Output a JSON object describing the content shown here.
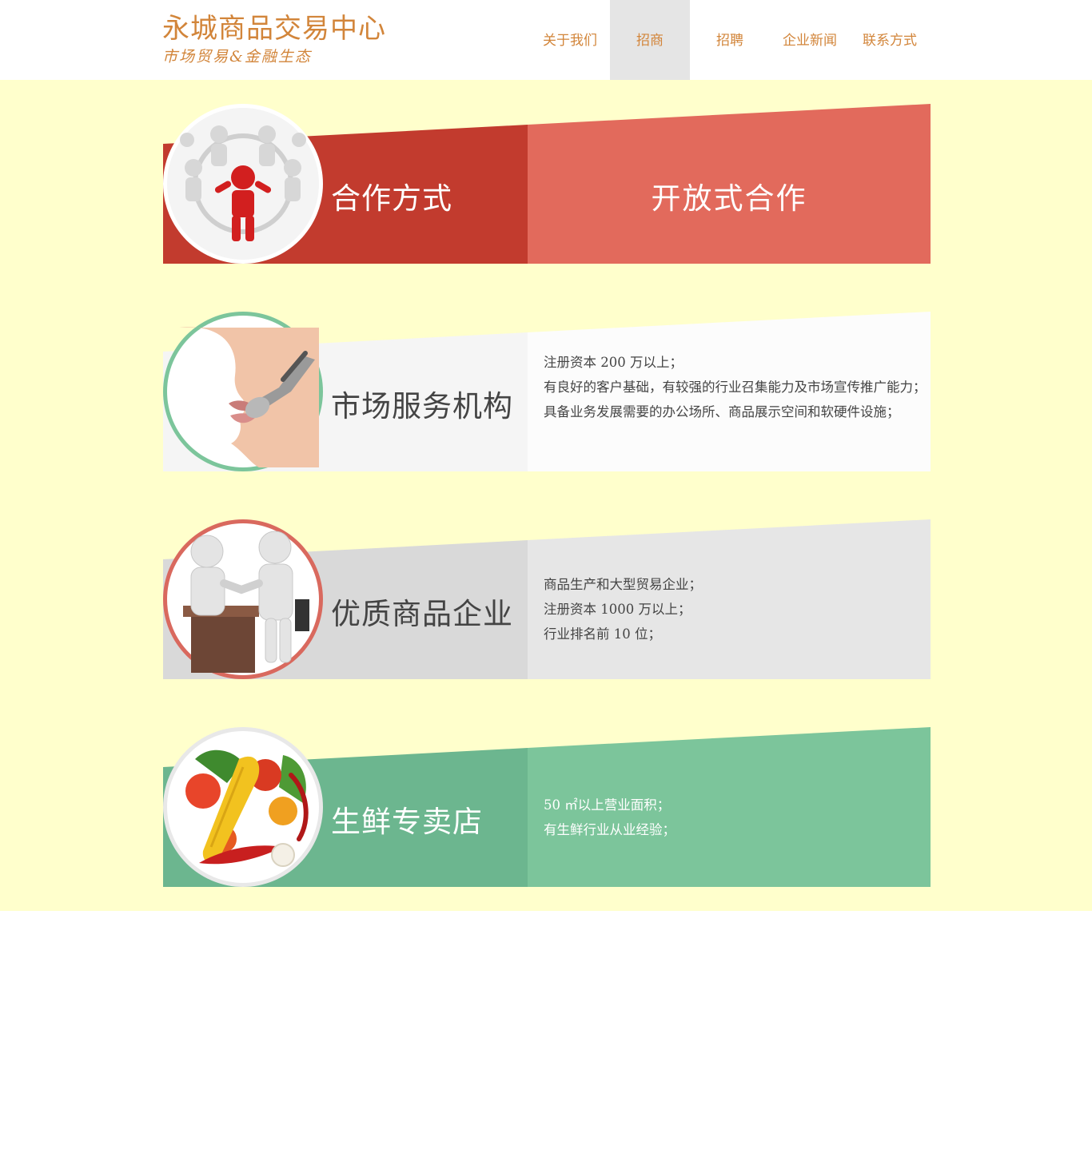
{
  "header": {
    "logo_title": "永城商品交易中心",
    "logo_subtitle": "市场贸易&金融生态",
    "nav": [
      {
        "label": "关于我们",
        "active": false
      },
      {
        "label": "招商",
        "active": true
      },
      {
        "label": "招聘",
        "active": false
      },
      {
        "label": "企业新闻",
        "active": false
      },
      {
        "label": "联系方式",
        "active": false
      }
    ]
  },
  "cards": [
    {
      "title": "合作方式",
      "right_title": "开放式合作",
      "lines": [],
      "colors": {
        "left": "#c23b2e",
        "right": "#e26a5c",
        "ring": "#ffffff",
        "title": "#ffffff",
        "text": "#ffffff"
      }
    },
    {
      "title": "市场服务机构",
      "right_title": "",
      "lines": [
        "注册资本 200 万以上；",
        "有良好的客户基础，有较强的行业召集能力及市场宣传推广能力；",
        "具备业务发展需要的办公场所、商品展示空间和软硬件设施；"
      ],
      "colors": {
        "left": "#f5f5f5",
        "right": "#fcfcfc",
        "ring": "#7cc59b",
        "title": "#444444",
        "text": "#444444"
      }
    },
    {
      "title": "优质商品企业",
      "right_title": "",
      "lines": [
        "商品生产和大型贸易企业；",
        "注册资本 1000 万以上；",
        "行业排名前 10 位；"
      ],
      "colors": {
        "left": "#d9d9d9",
        "right": "#e6e6e6",
        "ring": "#d9695e",
        "title": "#444444",
        "text": "#444444"
      }
    },
    {
      "title": "生鲜专卖店",
      "right_title": "",
      "lines": [
        "50 ㎡以上营业面积；",
        "有生鲜行业从业经验；"
      ],
      "colors": {
        "left": "#6cb68f",
        "right": "#7cc59b",
        "ring": "#e8e8e8",
        "title": "#ffffff",
        "text": "#ffffff"
      }
    }
  ],
  "icons": [
    "team-people-icon",
    "headset-mouth-icon",
    "handshake-icon",
    "vegetables-icon"
  ]
}
